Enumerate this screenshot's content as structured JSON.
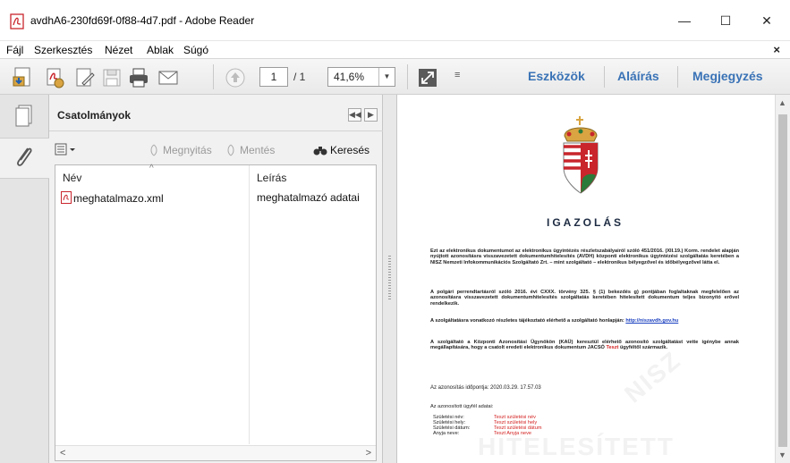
{
  "window": {
    "title": "avdhA6-230fd69f-0f88-4d7.pdf - Adobe Reader",
    "minimize": "—",
    "maximize": "☐",
    "close": "✕"
  },
  "menu": {
    "items": [
      "Fájl",
      "Szerkesztés",
      "Nézet",
      "Ablak",
      "Súgó"
    ],
    "close": "×"
  },
  "toolbar": {
    "page_current": "1",
    "page_total": "/ 1",
    "zoom": "41,6%",
    "links": [
      "Eszközök",
      "Aláírás",
      "Megjegyzés"
    ],
    "accent": "#3a73b6"
  },
  "panel": {
    "title": "Csatolmányok",
    "actions": {
      "open": "Megnyitás",
      "save": "Mentés",
      "search": "Keresés"
    },
    "columns": {
      "name": "Név",
      "description": "Leírás"
    },
    "rows": [
      {
        "name": "meghatalmazo.xml",
        "description": "meghatalmazó adatai"
      }
    ]
  },
  "document": {
    "title": "IGAZOLÁS",
    "para1": "Ezt az elektronikus dokumentumot az elektronikus ügyintézés részletszabályairól szóló 451/2016. (XII.19.) Korm. rendelet alapján nyújtott azonosításra visszavezetett dokumentumhitelesítés (AVDH) központi elektronikus ügyintézési szolgáltatás keretében a NISZ Nemzeti Infokommunikációs Szolgáltató Zrt. – mint szolgáltató – elektronikus bélyegzővel és időbélyegzővel látta el.",
    "para2": "A polgári perrendtartásról szóló 2016. évi CXXX. törvény 325. § (1) bekezdés g) pontjában foglaltaknak megfelelően az azonosításra visszavezetett dokumentumhitelesítés szolgáltatás keretében hitelesített dokumentum teljes bizonyító erővel rendelkezik.",
    "para3": "A szolgáltatásra vonatkozó részletes tájékoztató elérhető a szolgáltató honlapján:",
    "para3_link": "http://niszavdh.gov.hu",
    "para4": "A szolgáltató a Központi Azonosítási Ügynökön (KAÜ) keresztül elérhető azonosító szolgáltatást vette igénybe annak megállapítására, hogy a csatolt eredeti elektronikus dokumentum JACSÓ",
    "para4_red": "Teszt",
    "para4_end": "ügyféltől származik.",
    "timestamp": "Az azonosítás időpontja: 2020.03.29. 17.57.03",
    "client_label": "Az azonosított ügyfél adatai:",
    "fields": [
      {
        "label": "Születési név:",
        "value": "Teszt születési név"
      },
      {
        "label": "Születési hely:",
        "value": "Teszt születési hely"
      },
      {
        "label": "Születési dátum:",
        "value": "Teszt születési dátum"
      },
      {
        "label": "Anyja neve:",
        "value": "Teszt Anyja neve"
      }
    ],
    "watermark": "HITELESÍTETT"
  }
}
